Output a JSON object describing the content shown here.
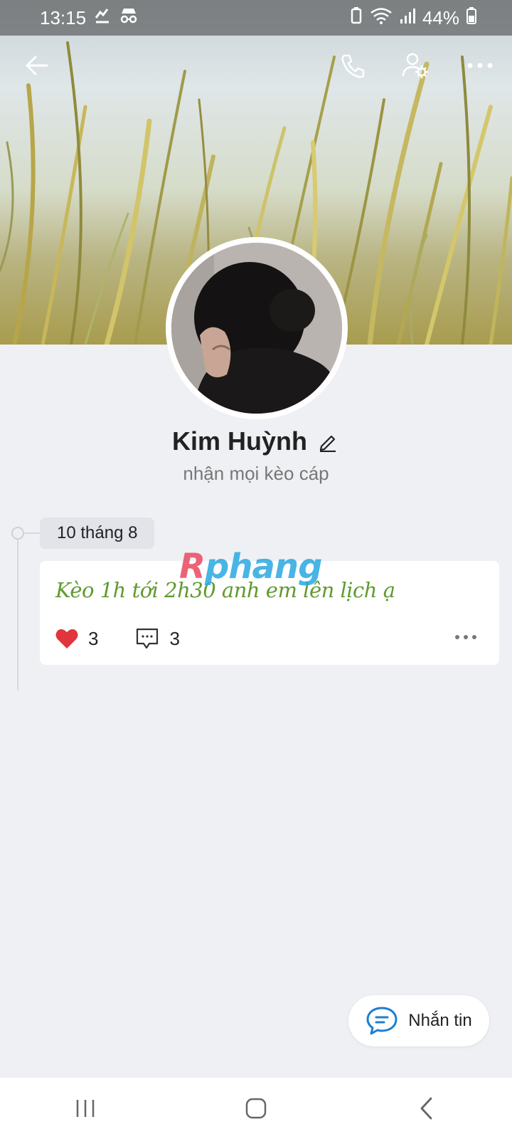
{
  "status_bar": {
    "time": "13:15",
    "battery": "44%",
    "icons": [
      "usb-tether-icon",
      "incognito-icon",
      "battery-saver-icon",
      "wifi-icon",
      "signal-icon",
      "battery-icon"
    ]
  },
  "header": {
    "icons": [
      "back-arrow-icon",
      "phone-icon",
      "user-settings-icon",
      "more-dots-icon"
    ]
  },
  "profile": {
    "name": "Kim Huỳnh",
    "bio": "nhận mọi kèo cáp"
  },
  "timeline": {
    "date": "10 tháng 8",
    "post": {
      "text": "Kèo 1h tới 2h30 anh em lên lịch ạ",
      "watermark_first": "R",
      "watermark_rest": "phang",
      "likes": "3",
      "comments": "3"
    }
  },
  "message_button": {
    "label": "Nhắn tin"
  },
  "nav": {
    "icons": [
      "recent-apps-icon",
      "home-icon",
      "back-icon"
    ]
  },
  "colors": {
    "accent": "#1a7fd1",
    "post_text": "#5f9a2f",
    "like_heart": "#e0353c",
    "background": "#eff0f4"
  }
}
